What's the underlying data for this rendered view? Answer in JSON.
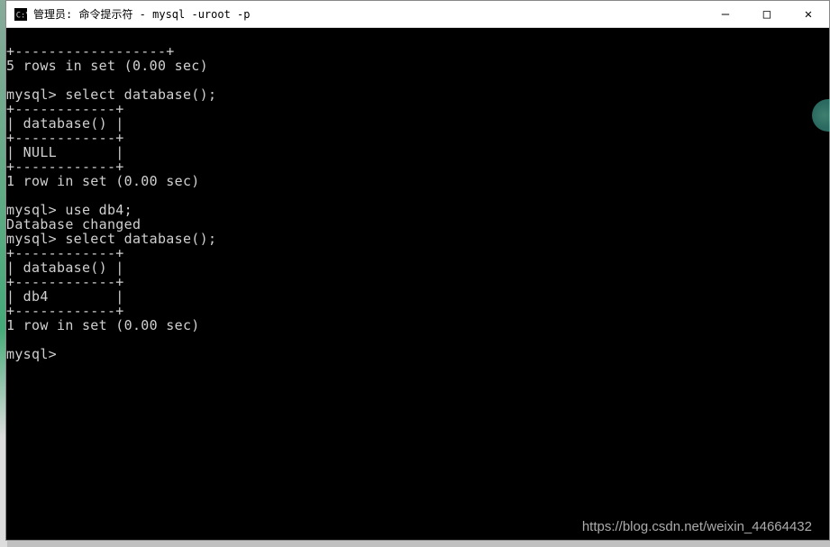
{
  "window": {
    "title": "管理员: 命令提示符 - mysql  -uroot -p",
    "controls": {
      "minimize": "—",
      "maximize": "□",
      "close": "✕"
    }
  },
  "terminal": {
    "lines": [
      "+------------------+",
      "5 rows in set (0.00 sec)",
      "",
      "mysql> select database();",
      "+------------+",
      "| database() |",
      "+------------+",
      "| NULL       |",
      "+------------+",
      "1 row in set (0.00 sec)",
      "",
      "mysql> use db4;",
      "Database changed",
      "mysql> select database();",
      "+------------+",
      "| database() |",
      "+------------+",
      "| db4        |",
      "+------------+",
      "1 row in set (0.00 sec)",
      "",
      "mysql>"
    ]
  },
  "watermark": "https://blog.csdn.net/weixin_44664432"
}
